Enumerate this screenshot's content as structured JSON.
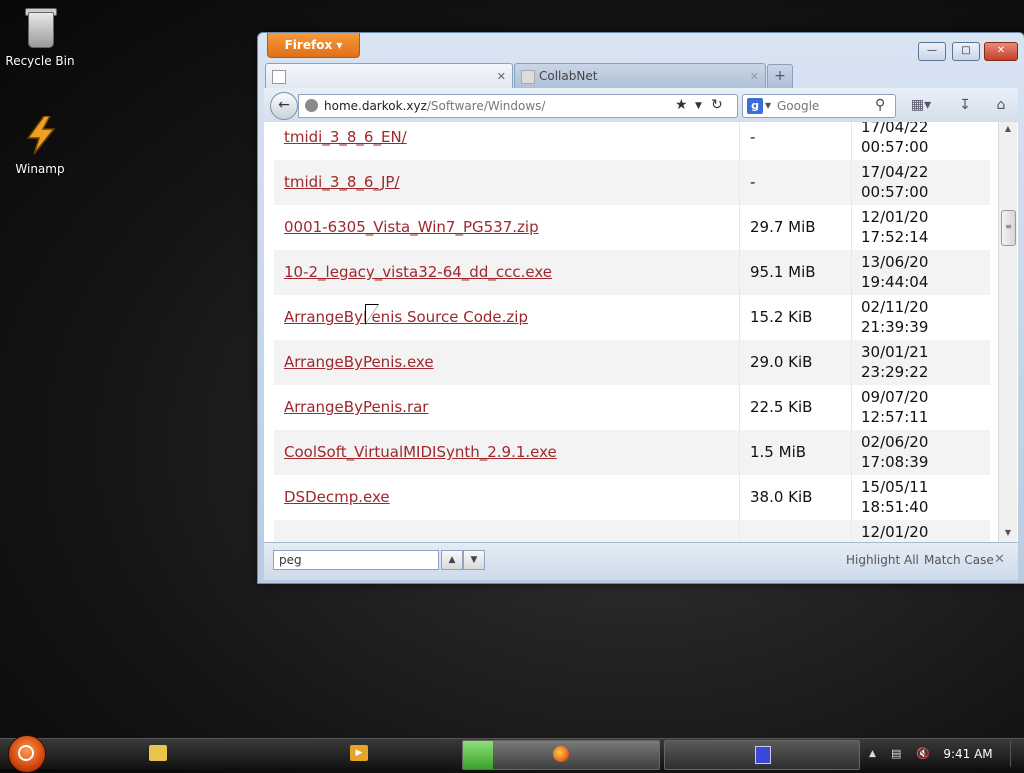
{
  "desktop": {
    "icons": [
      {
        "label": "Recycle Bin",
        "icon": "recycle-bin-icon"
      },
      {
        "label": "Winamp",
        "icon": "winamp-icon"
      }
    ]
  },
  "browser": {
    "menu_button": "Firefox",
    "tabs": [
      {
        "label": "",
        "active": true
      },
      {
        "label": "CollabNet",
        "active": false
      }
    ],
    "url": {
      "host": "home.darkok.xyz",
      "path": "/Software/Windows/"
    },
    "search": {
      "placeholder": "Google",
      "engine_icon": "g"
    },
    "files": [
      {
        "name": "tmidi_3_8_6_EN/",
        "size": "-",
        "date": "17/04/22",
        "time": "00:57:00"
      },
      {
        "name": "tmidi_3_8_6_JP/",
        "size": "-",
        "date": "17/04/22",
        "time": "00:57:00"
      },
      {
        "name": "0001-6305_Vista_Win7_PG537.zip",
        "size": "29.7 MiB",
        "date": "12/01/20",
        "time": "17:52:14"
      },
      {
        "name": "10-2_legacy_vista32-64_dd_ccc.exe",
        "size": "95.1 MiB",
        "date": "13/06/20",
        "time": "19:44:04"
      },
      {
        "name": "ArrangeByPenis Source Code.zip",
        "size": "15.2 KiB",
        "date": "02/11/20",
        "time": "21:39:39"
      },
      {
        "name": "ArrangeByPenis.exe",
        "size": "29.0 KiB",
        "date": "30/01/21",
        "time": "23:29:22"
      },
      {
        "name": "ArrangeByPenis.rar",
        "size": "22.5 KiB",
        "date": "09/07/20",
        "time": "12:57:11"
      },
      {
        "name": "CoolSoft_VirtualMIDISynth_2.9.1.exe",
        "size": "1.5 MiB",
        "date": "02/06/20",
        "time": "17:08:39"
      },
      {
        "name": "DSDecmp.exe",
        "size": "38.0 KiB",
        "date": "15/05/11",
        "time": "18:51:40"
      },
      {
        "name": "",
        "size": "",
        "date": "12/01/20",
        "time": ""
      }
    ],
    "findbar": {
      "query": "peg",
      "highlight_all": "Highlight All",
      "match_case": "Match Case"
    }
  },
  "taskbar": {
    "clock": "9:41 AM"
  },
  "colors": {
    "link": "#a0282c",
    "firefox_button": "#e8801f"
  }
}
